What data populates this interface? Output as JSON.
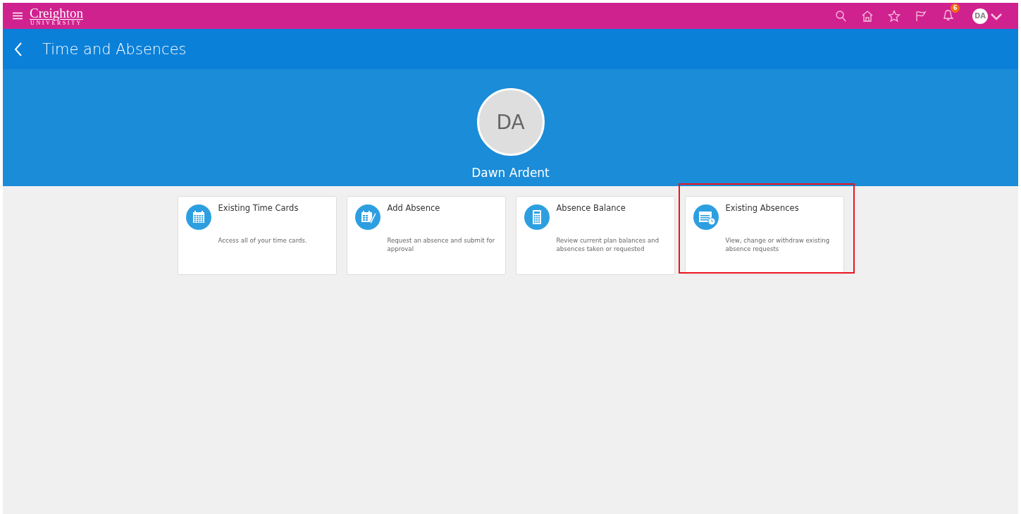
{
  "brand": {
    "name": "Creighton",
    "subtitle": "UNIVERSITY"
  },
  "header_icons": {
    "notification_count": "6",
    "avatar": "DA"
  },
  "page": {
    "title": "Time and Absences"
  },
  "profile": {
    "initials": "DA",
    "name": "Dawn Ardent"
  },
  "tiles": [
    {
      "kind": "calendar",
      "title": "Existing Time Cards",
      "description": "Access all of your time cards.",
      "highlighted": false
    },
    {
      "kind": "edit",
      "title": "Add Absence",
      "description": "Request an absence and submit for approval",
      "highlighted": false
    },
    {
      "kind": "calculator",
      "title": "Absence Balance",
      "description": "Review current plan balances and absences taken or requested",
      "highlighted": false
    },
    {
      "kind": "list",
      "title": "Existing Absences",
      "description": "View, change or withdraw existing absence requests",
      "highlighted": true
    }
  ]
}
